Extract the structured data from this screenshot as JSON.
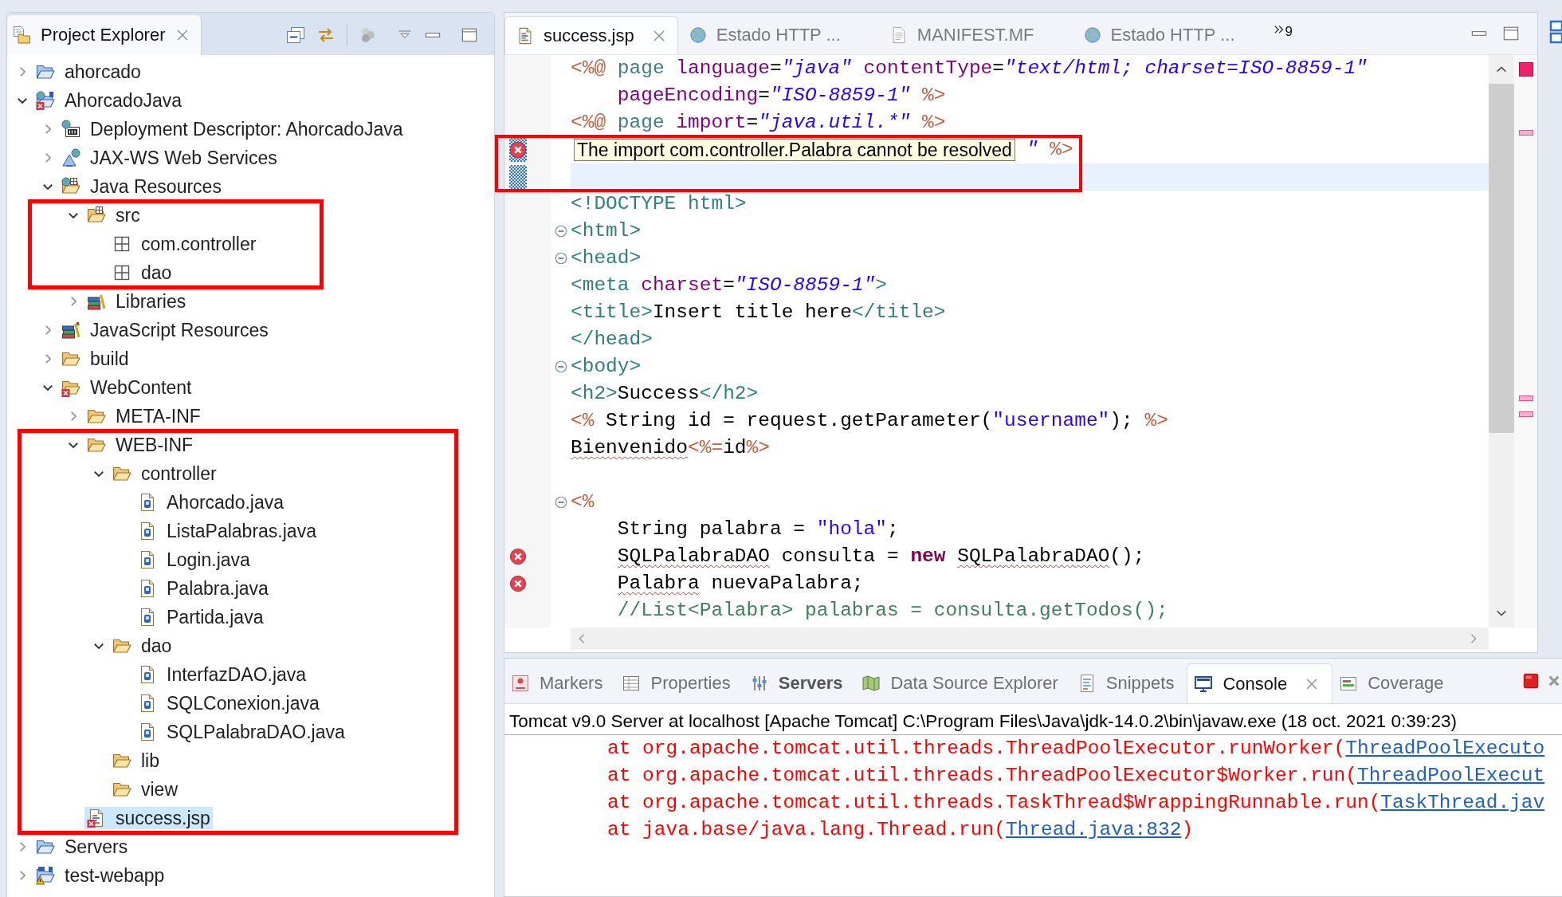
{
  "explorer": {
    "title": "Project Explorer",
    "tree": [
      {
        "label": "ahorcado",
        "kind": "project",
        "expanded": false,
        "selected": false
      },
      {
        "label": "AhorcadoJava",
        "kind": "web_project",
        "problem": {
          "kind": "error"
        },
        "expanded": true,
        "selected": false,
        "children": [
          {
            "label": "Deployment Descriptor: AhorcadoJava",
            "kind": "descriptor",
            "expanded": false,
            "selected": false
          },
          {
            "label": "JAX-WS Web Services",
            "kind": "web_services",
            "expanded": false,
            "selected": false
          },
          {
            "label": "Java Resources",
            "kind": "java_resources",
            "expanded": true,
            "selected": false,
            "children": [
              {
                "label": "src",
                "kind": "source_folder",
                "expanded": true,
                "selected": false,
                "children": [
                  {
                    "label": "com.controller",
                    "kind": "package",
                    "selected": false
                  },
                  {
                    "label": "dao",
                    "kind": "package",
                    "selected": false
                  }
                ]
              },
              {
                "label": "Libraries",
                "kind": "libraries",
                "expanded": false,
                "selected": false
              }
            ]
          },
          {
            "label": "JavaScript Resources",
            "kind": "js_resources",
            "expanded": false,
            "selected": false
          },
          {
            "label": "build",
            "kind": "folder",
            "expanded": false,
            "selected": false
          },
          {
            "label": "WebContent",
            "kind": "folder",
            "problem": {
              "kind": "error"
            },
            "expanded": true,
            "selected": false,
            "children": [
              {
                "label": "META-INF",
                "kind": "folder",
                "expanded": false,
                "selected": false
              },
              {
                "label": "WEB-INF",
                "kind": "folder",
                "expanded": true,
                "selected": false,
                "children": [
                  {
                    "label": "controller",
                    "kind": "folder",
                    "expanded": true,
                    "selected": false,
                    "children": [
                      {
                        "label": "Ahorcado.java",
                        "kind": "java_file",
                        "selected": false
                      },
                      {
                        "label": "ListaPalabras.java",
                        "kind": "java_file",
                        "selected": false
                      },
                      {
                        "label": "Login.java",
                        "kind": "java_file",
                        "selected": false
                      },
                      {
                        "label": "Palabra.java",
                        "kind": "java_file",
                        "selected": false
                      },
                      {
                        "label": "Partida.java",
                        "kind": "java_file",
                        "selected": false
                      }
                    ]
                  },
                  {
                    "label": "dao",
                    "kind": "folder",
                    "expanded": true,
                    "selected": false,
                    "children": [
                      {
                        "label": "InterfazDAO.java",
                        "kind": "java_file",
                        "selected": false
                      },
                      {
                        "label": "SQLConexion.java",
                        "kind": "java_file",
                        "selected": false
                      },
                      {
                        "label": "SQLPalabraDAO.java",
                        "kind": "java_file",
                        "selected": false
                      }
                    ]
                  },
                  {
                    "label": "lib",
                    "kind": "folder",
                    "selected": false
                  },
                  {
                    "label": "view",
                    "kind": "folder",
                    "selected": false
                  }
                ]
              },
              {
                "label": "success.jsp",
                "kind": "jsp_file",
                "problem": {
                  "kind": "error"
                },
                "selected": true
              }
            ]
          }
        ]
      },
      {
        "label": "Servers",
        "kind": "project",
        "expanded": false,
        "selected": false
      },
      {
        "label": "test-webapp",
        "kind": "module_project",
        "problem": {
          "kind": "warning"
        },
        "expanded": false,
        "selected": false
      }
    ],
    "annotations": [
      {
        "kind": "frame"
      },
      {
        "kind": "frame"
      }
    ]
  },
  "editor": {
    "tabs": [
      {
        "label": "success.jsp",
        "kind": "jsp",
        "selected": true
      },
      {
        "label": "Estado HTTP ...",
        "kind": "browser",
        "selected": false
      },
      {
        "label": "MANIFEST.MF",
        "kind": "text",
        "selected": false
      },
      {
        "label": "Estado HTTP ...",
        "kind": "browser",
        "selected": false
      }
    ],
    "overflow_count": "9",
    "lines": [
      {
        "tokens": [
          {
            "text": "<%@",
            "kind": "delim"
          },
          {
            "text": " page",
            "kind": "directive"
          },
          {
            "text": " language",
            "kind": "attr"
          },
          {
            "text": "=",
            "kind": "text"
          },
          {
            "text": "\"java\"",
            "kind": "value"
          },
          {
            "text": " contentType",
            "kind": "attr"
          },
          {
            "text": "=",
            "kind": "text"
          },
          {
            "text": "\"text/html; charset=ISO-8859-1\"",
            "kind": "value"
          }
        ],
        "current": false,
        "changed": false
      },
      {
        "tokens": [
          {
            "text": "    pageEncoding",
            "kind": "attr"
          },
          {
            "text": "=",
            "kind": "text"
          },
          {
            "text": "\"ISO-8859-1\"",
            "kind": "value"
          },
          {
            "text": " %>",
            "kind": "delim"
          }
        ],
        "current": false,
        "changed": false
      },
      {
        "tokens": [
          {
            "text": "<%@",
            "kind": "delim"
          },
          {
            "text": " page",
            "kind": "directive"
          },
          {
            "text": " import",
            "kind": "attr"
          },
          {
            "text": "=",
            "kind": "text"
          },
          {
            "text": "\"java.util.*\"",
            "kind": "value"
          },
          {
            "text": " %>",
            "kind": "delim"
          }
        ],
        "current": false,
        "changed": false
      },
      {
        "tooltip": "The import com.controller.Palabra cannot be resolved",
        "tokens": [
          {
            "text": "\"",
            "kind": "value"
          },
          {
            "text": " %>",
            "kind": "delim"
          }
        ],
        "gutter_mark": {
          "kind": "error"
        },
        "current": false,
        "changed": true
      },
      {
        "current": true,
        "changed": true
      },
      {
        "tokens": [
          {
            "text": "<!DOCTYPE html>",
            "kind": "tag"
          }
        ],
        "current": false,
        "changed": false
      },
      {
        "tokens": [
          {
            "text": "<html>",
            "kind": "tag"
          }
        ],
        "expanded": true,
        "current": false,
        "changed": false
      },
      {
        "tokens": [
          {
            "text": "<head>",
            "kind": "tag"
          }
        ],
        "expanded": true,
        "current": false,
        "changed": false
      },
      {
        "tokens": [
          {
            "text": "<meta",
            "kind": "tag"
          },
          {
            "text": " charset",
            "kind": "attr"
          },
          {
            "text": "=",
            "kind": "text"
          },
          {
            "text": "\"ISO-8859-1\"",
            "kind": "value"
          },
          {
            "text": ">",
            "kind": "tag"
          }
        ],
        "current": false,
        "changed": false
      },
      {
        "tokens": [
          {
            "text": "<title>",
            "kind": "tag"
          },
          {
            "text": "Insert title here",
            "kind": "text"
          },
          {
            "text": "</title>",
            "kind": "tag"
          }
        ],
        "current": false,
        "changed": false
      },
      {
        "tokens": [
          {
            "text": "</head>",
            "kind": "tag"
          }
        ],
        "current": false,
        "changed": false
      },
      {
        "tokens": [
          {
            "text": "<body>",
            "kind": "tag"
          }
        ],
        "expanded": true,
        "current": false,
        "changed": false
      },
      {
        "tokens": [
          {
            "text": "<h2>",
            "kind": "tag"
          },
          {
            "text": "Success",
            "kind": "text"
          },
          {
            "text": "</h2>",
            "kind": "tag"
          }
        ],
        "current": false,
        "changed": false
      },
      {
        "tokens": [
          {
            "text": "<%",
            "kind": "delim"
          },
          {
            "text": " String id = request.getParameter(",
            "kind": "text"
          },
          {
            "text": "\"username\"",
            "kind": "string"
          },
          {
            "text": "); ",
            "kind": "text"
          },
          {
            "text": "%>",
            "kind": "delim"
          }
        ],
        "current": false,
        "changed": false
      },
      {
        "tokens": [
          {
            "text": "Bienvenido",
            "kind": "squiggle"
          },
          {
            "text": "<%=",
            "kind": "delim"
          },
          {
            "text": "id",
            "kind": "text"
          },
          {
            "text": "%>",
            "kind": "delim"
          }
        ],
        "current": false,
        "changed": false
      },
      {
        "current": false,
        "changed": false
      },
      {
        "tokens": [
          {
            "text": "<%",
            "kind": "delim"
          }
        ],
        "expanded": true,
        "current": false,
        "changed": false
      },
      {
        "tokens": [
          {
            "text": "    String palabra = ",
            "kind": "text"
          },
          {
            "text": "\"hola\"",
            "kind": "string"
          },
          {
            "text": ";",
            "kind": "text"
          }
        ],
        "current": false,
        "changed": false
      },
      {
        "tokens": [
          {
            "text": "    SQLPalabraDAO",
            "kind": "squiggle"
          },
          {
            "text": " consulta = ",
            "kind": "text"
          },
          {
            "text": "new ",
            "kind": "keyword"
          },
          {
            "text": "SQLPalabraDAO",
            "kind": "squiggle"
          },
          {
            "text": "();",
            "kind": "text"
          }
        ],
        "gutter_mark": {
          "kind": "error"
        },
        "current": false,
        "changed": false
      },
      {
        "tokens": [
          {
            "text": "    Palabra",
            "kind": "squiggle"
          },
          {
            "text": " nuevaPalabra;",
            "kind": "text"
          }
        ],
        "gutter_mark": {
          "kind": "error"
        },
        "current": false,
        "changed": false
      },
      {
        "tokens": [
          {
            "text": "    //List<Palabra> palabras = consulta.getTodos();",
            "kind": "comment"
          }
        ],
        "current": false,
        "changed": false
      }
    ],
    "annotations": [
      {
        "kind": "frame"
      }
    ]
  },
  "console": {
    "tabs": [
      {
        "label": "Markers",
        "kind": "markers",
        "selected": false,
        "updated": false
      },
      {
        "label": "Properties",
        "kind": "properties",
        "selected": false,
        "updated": false
      },
      {
        "label": "Servers",
        "kind": "servers",
        "selected": false,
        "updated": true
      },
      {
        "label": "Data Source Explorer",
        "kind": "data_source",
        "selected": false,
        "updated": false
      },
      {
        "label": "Snippets",
        "kind": "snippets",
        "selected": false,
        "updated": false
      },
      {
        "label": "Console",
        "kind": "console",
        "selected": true,
        "updated": false
      },
      {
        "label": "Coverage",
        "kind": "coverage",
        "selected": false,
        "updated": false
      }
    ],
    "header": "Tomcat v9.0 Server at localhost [Apache Tomcat] C:\\Program Files\\Java\\jdk-14.0.2\\bin\\javaw.exe (18 oct. 2021 0:39:23)",
    "lines": [
      {
        "segments": [
          {
            "text": "at org.apache.tomcat.util.threads.ThreadPoolExecutor.runWorker(",
            "kind": "text"
          },
          {
            "text": "ThreadPoolExecuto",
            "kind": "link"
          }
        ]
      },
      {
        "segments": [
          {
            "text": "at org.apache.tomcat.util.threads.ThreadPoolExecutor$Worker.run(",
            "kind": "text"
          },
          {
            "text": "ThreadPoolExecut",
            "kind": "link"
          }
        ]
      },
      {
        "segments": [
          {
            "text": "at org.apache.tomcat.util.threads.TaskThread$WrappingRunnable.run(",
            "kind": "text"
          },
          {
            "text": "TaskThread.jav",
            "kind": "link"
          }
        ]
      },
      {
        "segments": [
          {
            "text": "at java.base/java.lang.Thread.run(",
            "kind": "text"
          },
          {
            "text": "Thread.java:832",
            "kind": "link"
          },
          {
            "text": ")",
            "kind": "text"
          }
        ]
      }
    ]
  }
}
